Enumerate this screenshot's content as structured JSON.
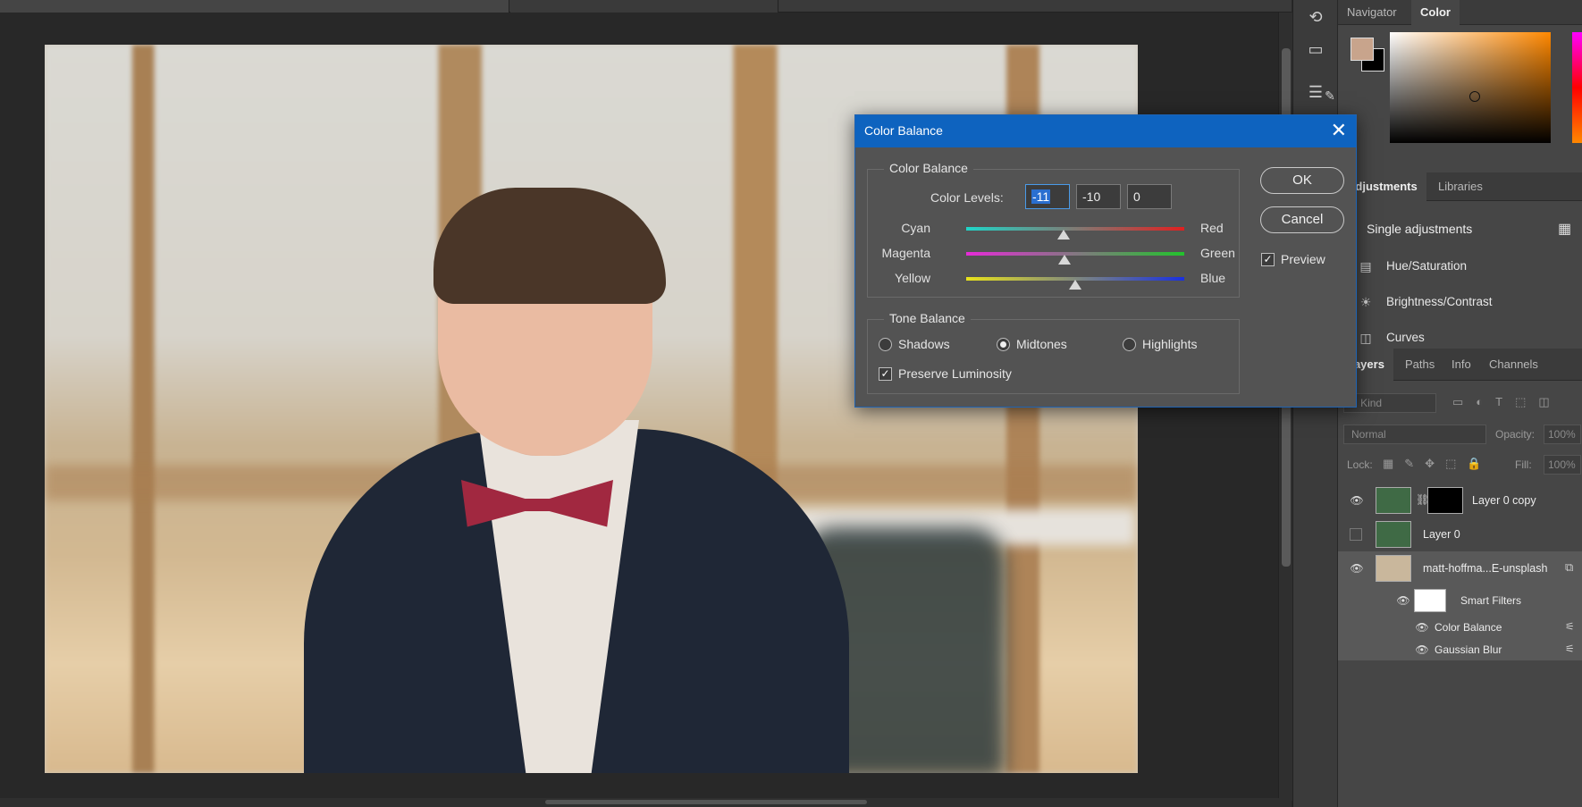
{
  "canvas": {
    "image_alt": "Portrait of a young man in a navy suit with a red bow tie against a blurred window background"
  },
  "color_panel": {
    "tabs": [
      {
        "label": "Navigator"
      },
      {
        "label": "Color"
      }
    ],
    "foreground": "#c8a48c",
    "background": "#000000"
  },
  "adjustments_panel": {
    "tabs": [
      {
        "label": "Adjustments"
      },
      {
        "label": "Libraries"
      }
    ],
    "section_label": "Single adjustments",
    "items": [
      {
        "label": "Hue/Saturation",
        "icon": "hue-saturation-icon"
      },
      {
        "label": "Brightness/Contrast",
        "icon": "brightness-contrast-icon"
      },
      {
        "label": "Curves",
        "icon": "curves-icon"
      }
    ]
  },
  "layers_panel": {
    "tabs": [
      {
        "label": "Layers"
      },
      {
        "label": "Paths"
      },
      {
        "label": "Info"
      },
      {
        "label": "Channels"
      }
    ],
    "filter_placeholder": "Kind",
    "blend_mode": "Normal",
    "opacity_label": "Opacity:",
    "opacity_value": "100%",
    "lock_label": "Lock:",
    "fill_label": "Fill:",
    "fill_value": "100%",
    "layers": [
      {
        "name": "Layer 0 copy"
      },
      {
        "name": "Layer 0"
      },
      {
        "name": "matt-hoffma...E-unsplash"
      }
    ],
    "smart_filters_label": "Smart Filters",
    "filters": [
      {
        "name": "Color Balance"
      },
      {
        "name": "Gaussian Blur"
      }
    ]
  },
  "dialog": {
    "title": "Color Balance",
    "color_balance_group": "Color Balance",
    "color_levels_label": "Color Levels:",
    "levels": [
      "-11",
      "-10",
      "0"
    ],
    "sliders": [
      {
        "left": "Cyan",
        "right": "Red",
        "value": -11
      },
      {
        "left": "Magenta",
        "right": "Green",
        "value": -10
      },
      {
        "left": "Yellow",
        "right": "Blue",
        "value": 0
      }
    ],
    "tone_balance_group": "Tone Balance",
    "tones": [
      {
        "label": "Shadows",
        "selected": false
      },
      {
        "label": "Midtones",
        "selected": true
      },
      {
        "label": "Highlights",
        "selected": false
      }
    ],
    "preserve_luminosity_label": "Preserve Luminosity",
    "preserve_luminosity": true,
    "ok_label": "OK",
    "cancel_label": "Cancel",
    "preview_label": "Preview",
    "preview": true
  }
}
